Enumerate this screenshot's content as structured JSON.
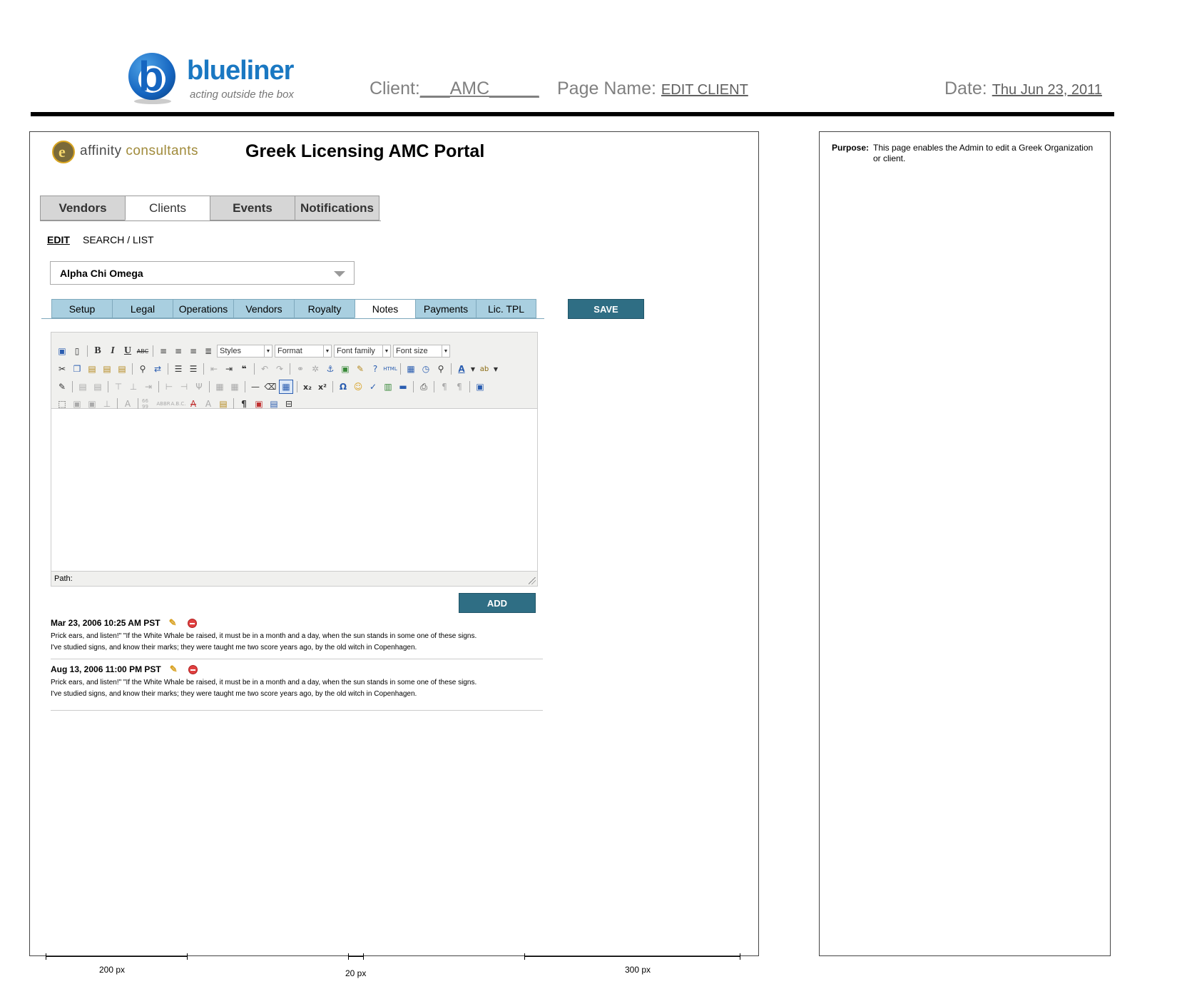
{
  "header": {
    "brand": "blueliner",
    "tagline": "acting outside the box",
    "client_label": "Client:",
    "client_value": "___AMC_____",
    "page_name_label": "Page Name:",
    "page_name_value": "EDIT CLIENT",
    "date_label": "Date:",
    "date_value": "Thu Jun 23, 2011"
  },
  "purpose": {
    "label": "Purpose:",
    "text": "This page enables the Admin to edit a Greek Organization or client."
  },
  "app": {
    "logo_text_a": "affinity",
    "logo_text_b": "consultants",
    "title": "Greek Licensing AMC Portal",
    "main_tabs": [
      "Vendors",
      "Clients",
      "Events",
      "Notifications"
    ],
    "main_tab_active": "Clients",
    "subnav": [
      "EDIT",
      "SEARCH / LIST"
    ],
    "client_select": "Alpha Chi Omega",
    "sub_tabs": [
      "Setup",
      "Legal",
      "Operations",
      "Vendors",
      "Royalty",
      "Notes",
      "Payments",
      "Lic. TPL"
    ],
    "sub_tab_active": "Notes",
    "save_label": "SAVE",
    "add_label": "ADD"
  },
  "editor": {
    "styles": "Styles",
    "format": "Format",
    "font_family": "Font family",
    "font_size": "Font size",
    "path_label": "Path:"
  },
  "notes": [
    {
      "timestamp": "Mar 23, 2006 10:25 AM PST",
      "line1": "Prick ears, and listen!\" \"If the White Whale be raised, it must be in a month and a day, when the sun stands in some one of these signs.",
      "line2": "I've studied signs, and know their marks; they were taught me two score years ago, by the old witch in Copenhagen."
    },
    {
      "timestamp": "Aug 13, 2006 11:00 PM PST",
      "line1": "Prick ears, and listen!\" \"If the White Whale be raised, it must be in a month and a day, when the sun stands in some one of these signs.",
      "line2": "I've studied signs, and know their marks; they were taught me two score years ago, by the old witch in Copenhagen."
    }
  ],
  "measurements": [
    "200 px",
    "20 px",
    "300 px"
  ],
  "colors": {
    "brand_blue": "#1a78c2",
    "button": "#2f6e84",
    "subtab": "#a9cfe0"
  }
}
